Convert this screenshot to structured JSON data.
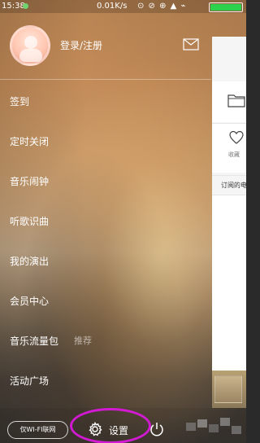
{
  "status_bar": {
    "time": "15:38",
    "network_speed": "0.01K/s",
    "icons_text": "⊙ ⊘ ⊕ ▲ ⌁"
  },
  "drawer": {
    "login_label": "登录/注册",
    "menu_items": [
      {
        "label": "签到"
      },
      {
        "label": "定时关闭"
      },
      {
        "label": "音乐闹钟"
      },
      {
        "label": "听歌识曲"
      },
      {
        "label": "我的演出"
      },
      {
        "label": "会员中心"
      },
      {
        "label": "音乐流量包",
        "sub_label": "推荐"
      },
      {
        "label": "活动广场"
      }
    ]
  },
  "right_panel": {
    "collect_label": "收藏",
    "subscribe_label": "订阅的电"
  },
  "bottom_bar": {
    "wifi_only_label": "仅WI-FI联网",
    "settings_label": "设置"
  },
  "colors": {
    "highlight_oval": "#d11ad1",
    "battery": "#2dd14b"
  },
  "icons": [
    "mail-icon",
    "folder-icon",
    "heart-icon",
    "gear-icon",
    "power-icon"
  ]
}
